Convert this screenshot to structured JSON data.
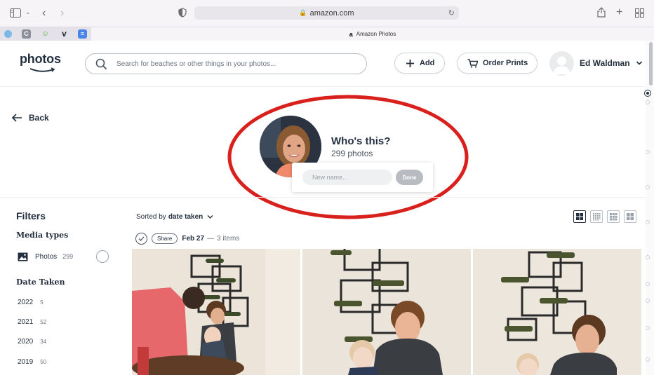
{
  "browser": {
    "url": "amazon.com",
    "tab_title": "Amazon Photos",
    "tab_logo": "a"
  },
  "header": {
    "logo_text": "photos",
    "search_placeholder": "Search for beaches or other things in your photos...",
    "add_label": "Add",
    "order_prints_label": "Order Prints",
    "user_name": "Ed Waldman"
  },
  "person": {
    "back_label": "Back",
    "title": "Who's this?",
    "count": "299 photos",
    "name_placeholder": "New name...",
    "done_label": "Done"
  },
  "filters": {
    "title": "Filters",
    "media_heading": "Media types",
    "media": {
      "label": "Photos",
      "count": "299"
    },
    "date_heading": "Date Taken",
    "years": [
      {
        "year": "2022",
        "count": "5"
      },
      {
        "year": "2021",
        "count": "52"
      },
      {
        "year": "2020",
        "count": "34"
      },
      {
        "year": "2019",
        "count": "50"
      }
    ]
  },
  "gallery": {
    "sort_prefix": "Sorted by",
    "sort_value": "date taken",
    "share_label": "Share",
    "date_label": "Feb 27",
    "date_sep": "—",
    "date_count": "3 items"
  },
  "colors": {
    "annotation_red": "#d8201c",
    "brand_dark": "#232f3e"
  }
}
